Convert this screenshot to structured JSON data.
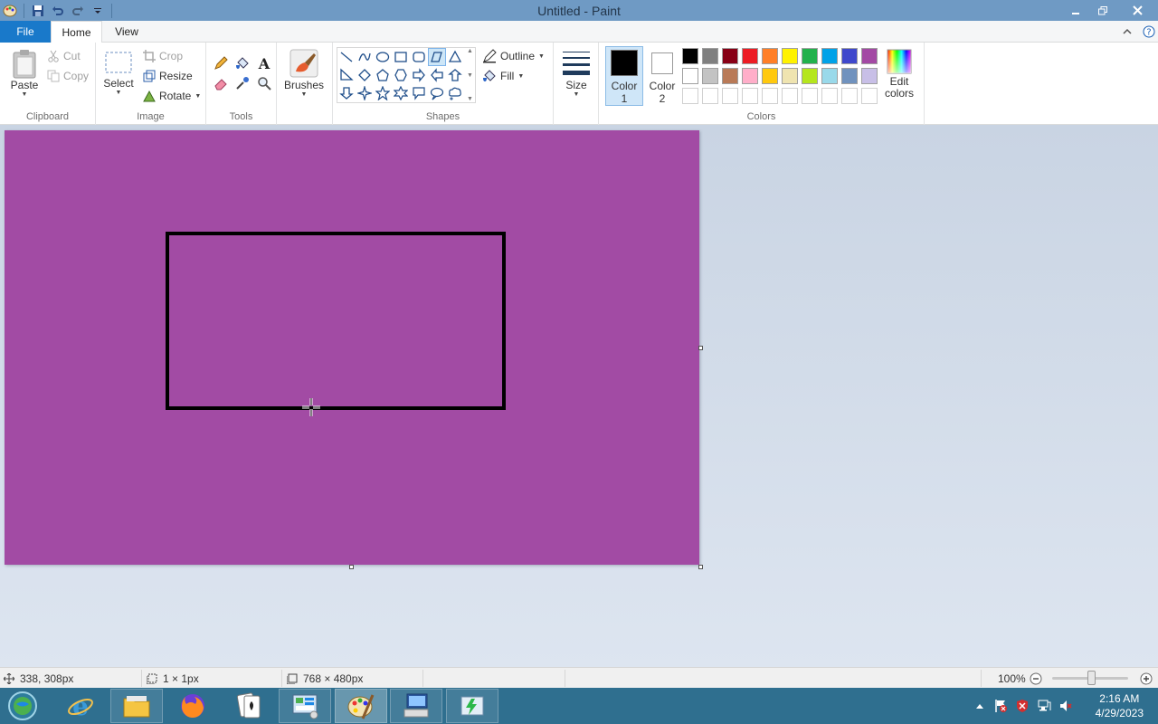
{
  "window": {
    "title": "Untitled - Paint"
  },
  "tabs": {
    "file": "File",
    "home": "Home",
    "view": "View"
  },
  "clipboard": {
    "paste": "Paste",
    "cut": "Cut",
    "copy": "Copy",
    "group": "Clipboard"
  },
  "image": {
    "select": "Select",
    "crop": "Crop",
    "resize": "Resize",
    "rotate": "Rotate",
    "group": "Image"
  },
  "tools": {
    "group": "Tools"
  },
  "brushes": {
    "label": "Brushes"
  },
  "shapes": {
    "outline": "Outline",
    "fill": "Fill",
    "group": "Shapes"
  },
  "size": {
    "label": "Size"
  },
  "colors": {
    "color1_line1": "Color",
    "color1_line2": "1",
    "color2_line1": "Color",
    "color2_line2": "2",
    "edit_line1": "Edit",
    "edit_line2": "colors",
    "group": "Colors",
    "color1": "#000000",
    "color2": "#ffffff",
    "palette_row1": [
      "#000000",
      "#7f7f7f",
      "#880015",
      "#ed1c24",
      "#ff7f27",
      "#fff200",
      "#22b14c",
      "#00a2e8",
      "#3f48cc",
      "#a349a4"
    ],
    "palette_row2": [
      "#ffffff",
      "#c3c3c3",
      "#b97a57",
      "#ffaec9",
      "#ffc90e",
      "#efe4b0",
      "#b5e61d",
      "#99d9ea",
      "#7092be",
      "#c8bfe7"
    ]
  },
  "canvas": {
    "background": "#a24ba4"
  },
  "status": {
    "cursor_pos": "338, 308px",
    "selection_size": "1 × 1px",
    "image_size": "768 × 480px",
    "zoom": "100%"
  },
  "taskbar": {
    "time": "2:16 AM",
    "date": "4/29/2023"
  }
}
